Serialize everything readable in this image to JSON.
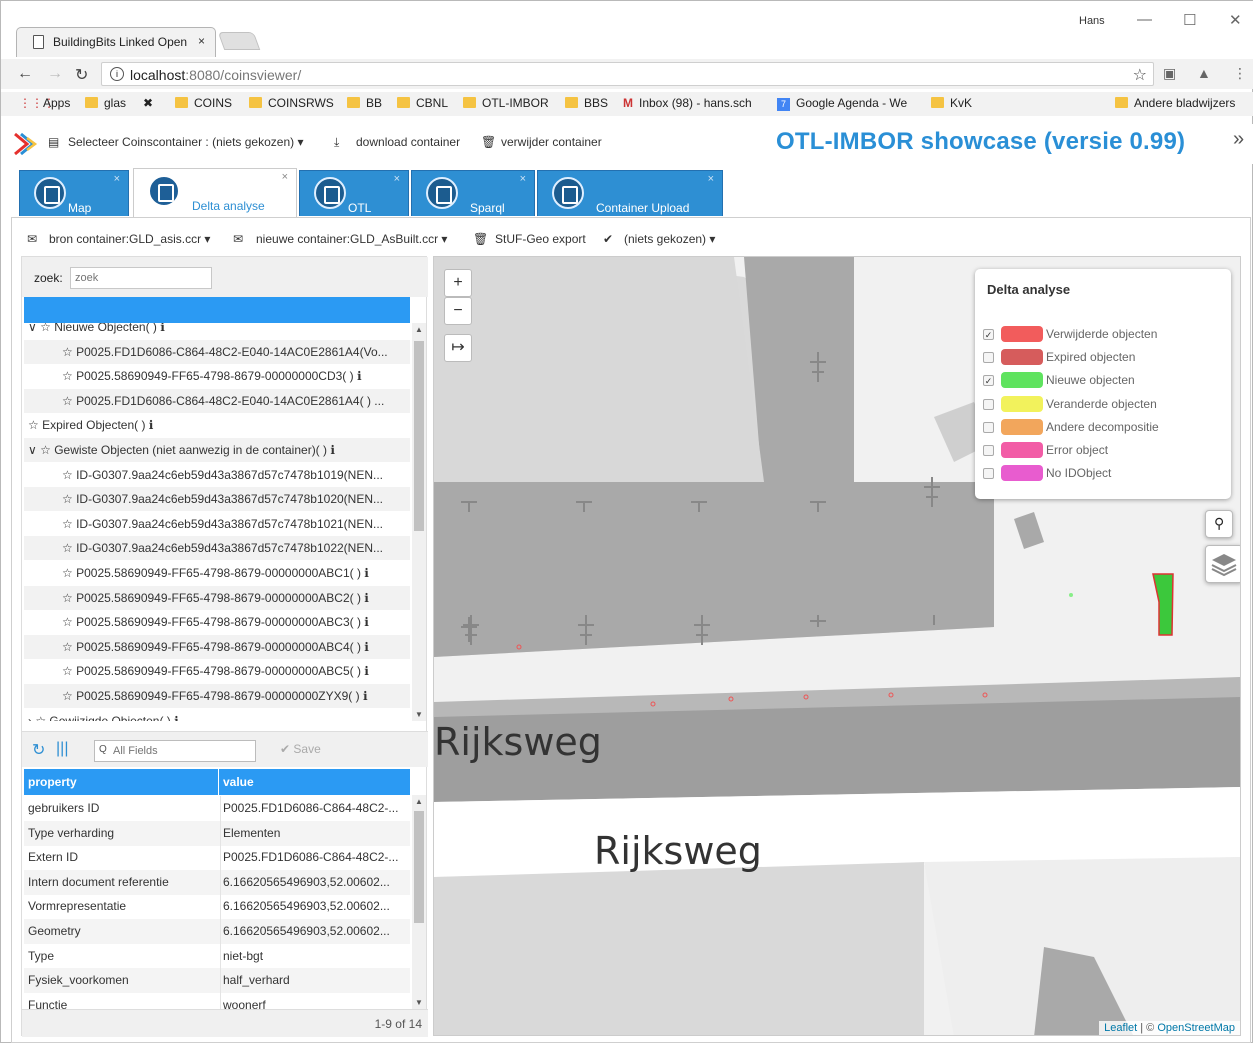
{
  "browser": {
    "tab_title": "BuildingBits Linked Open",
    "tab_close": "×",
    "user": "Hans",
    "url_host": "localhost",
    "url_path": ":8080/coinsviewer/",
    "bookmarks": [
      "Apps",
      "glas",
      "COINS",
      "COINSRWS",
      "BB",
      "CBNL",
      "OTL-IMBOR",
      "BBS",
      "Inbox (98) - hans.sch",
      "Google Agenda - We",
      "KvK"
    ],
    "other_bookmarks": "Andere bladwijzers"
  },
  "app": {
    "select_container": "Selecteer Coinscontainer : (niets gekozen)",
    "download": "download container",
    "delete": "verwijder container",
    "title": "OTL-IMBOR showcase (versie 0.99)",
    "more": "»"
  },
  "tabs": [
    {
      "label": "Map",
      "close": "×"
    },
    {
      "label": "Delta analyse",
      "close": "×"
    },
    {
      "label": "OTL",
      "close": "×"
    },
    {
      "label": "Sparql",
      "close": "×"
    },
    {
      "label": "Container Upload",
      "close": "×"
    }
  ],
  "subbar": {
    "source": "bron container:GLD_asis.ccr",
    "new": "nieuwe container:GLD_AsBuilt.ccr",
    "export": "StUF-Geo export",
    "chosen": "(niets gekozen)"
  },
  "search": {
    "label": "zoek:",
    "placeholder": "zoek"
  },
  "tree": [
    {
      "text": "∨ ☆ Nieuwe Objecten( ) ℹ",
      "indent": 4
    },
    {
      "text": "☆ P0025.FD1D6086-C864-48C2-E040-14AC0E2861A4(Vo...",
      "indent": 38
    },
    {
      "text": "☆ P0025.58690949-FF65-4798-8679-00000000CD3( ) ℹ",
      "indent": 38
    },
    {
      "text": "☆ P0025.FD1D6086-C864-48C2-E040-14AC0E2861A4( ) ...",
      "indent": 38
    },
    {
      "text": "☆ Expired Objecten( ) ℹ",
      "indent": 4
    },
    {
      "text": "∨ ☆ Gewiste Objecten (niet aanwezig in de container)( ) ℹ",
      "indent": 4
    },
    {
      "text": "☆ ID-G0307.9aa24c6eb59d43a3867d57c7478b1019(NEN...",
      "indent": 38
    },
    {
      "text": "☆ ID-G0307.9aa24c6eb59d43a3867d57c7478b1020(NEN...",
      "indent": 38
    },
    {
      "text": "☆ ID-G0307.9aa24c6eb59d43a3867d57c7478b1021(NEN...",
      "indent": 38
    },
    {
      "text": "☆ ID-G0307.9aa24c6eb59d43a3867d57c7478b1022(NEN...",
      "indent": 38
    },
    {
      "text": "☆ P0025.58690949-FF65-4798-8679-00000000ABC1( ) ℹ",
      "indent": 38
    },
    {
      "text": "☆ P0025.58690949-FF65-4798-8679-00000000ABC2( ) ℹ",
      "indent": 38
    },
    {
      "text": "☆ P0025.58690949-FF65-4798-8679-00000000ABC3( ) ℹ",
      "indent": 38
    },
    {
      "text": "☆ P0025.58690949-FF65-4798-8679-00000000ABC4( ) ℹ",
      "indent": 38
    },
    {
      "text": "☆ P0025.58690949-FF65-4798-8679-00000000ABC5( ) ℹ",
      "indent": 38
    },
    {
      "text": "☆ P0025.58690949-FF65-4798-8679-00000000ZYX9( ) ℹ",
      "indent": 38
    },
    {
      "text": "› ☆ Gewijzigde Objecten( ) ℹ",
      "indent": 4
    }
  ],
  "props": {
    "search_placeholder": "All Fields",
    "save": "Save",
    "headers": [
      "property",
      "value"
    ],
    "rows": [
      [
        "gebruikers ID",
        "P0025.FD1D6086-C864-48C2-..."
      ],
      [
        "Type verharding",
        "Elementen"
      ],
      [
        "Extern ID",
        "P0025.FD1D6086-C864-48C2-..."
      ],
      [
        "Intern document referentie",
        "6.16620565496903,52.00602..."
      ],
      [
        "Vormrepresentatie",
        "6.16620565496903,52.00602..."
      ],
      [
        "Geometry",
        "6.16620565496903,52.00602..."
      ],
      [
        "Type",
        "niet-bgt"
      ],
      [
        "Fysiek_voorkomen",
        "half_verhard"
      ],
      [
        "Functie",
        "woonerf"
      ]
    ],
    "pager": "1-9 of 14"
  },
  "map": {
    "zoom_in": "+",
    "zoom_out": "−",
    "expand": "↦",
    "street1": "Rijksweg",
    "street2": "Rijksweg",
    "legend_title": "Delta analyse",
    "legend": [
      {
        "label": "Verwijderde objecten",
        "color": "#f25c5c",
        "checked": true
      },
      {
        "label": "Expired objecten",
        "color": "#d65c5c",
        "checked": false
      },
      {
        "label": "Nieuwe objecten",
        "color": "#5fe35f",
        "checked": true
      },
      {
        "label": "Veranderde objecten",
        "color": "#f2f25c",
        "checked": false
      },
      {
        "label": "Andere decompositie",
        "color": "#f2a65c",
        "checked": false
      },
      {
        "label": "Error object",
        "color": "#f25ca6",
        "checked": false
      },
      {
        "label": "No IDObject",
        "color": "#e85ccf",
        "checked": false
      }
    ],
    "attribution_leaflet": "Leaflet",
    "attribution_rest": " | © ",
    "attribution_osm": "OpenStreetMap"
  }
}
